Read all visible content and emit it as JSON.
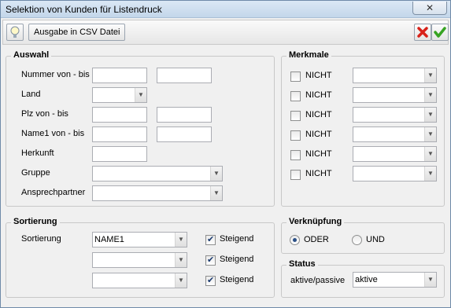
{
  "window": {
    "title": "Selektion von Kunden für Listendruck",
    "close_icon": "close-icon"
  },
  "toolbar": {
    "hint_icon": "lightbulb-icon",
    "csv_export_label": "Ausgabe in CSV Datei",
    "cancel_icon": "red-x-icon",
    "confirm_icon": "green-check-icon"
  },
  "auswahl": {
    "legend": "Auswahl",
    "fields": {
      "nummer": {
        "label": "Nummer von - bis",
        "from": "",
        "to": ""
      },
      "land": {
        "label": "Land",
        "value": ""
      },
      "plz": {
        "label": "Plz von - bis",
        "from": "",
        "to": ""
      },
      "name1": {
        "label": "Name1 von - bis",
        "from": "",
        "to": ""
      },
      "herkunft": {
        "label": "Herkunft",
        "value": ""
      },
      "gruppe": {
        "label": "Gruppe",
        "value": ""
      },
      "ansprechpartner": {
        "label": "Ansprechpartner",
        "value": ""
      }
    }
  },
  "merkmale": {
    "legend": "Merkmale",
    "rows": [
      {
        "label": "NICHT",
        "checked": false,
        "value": ""
      },
      {
        "label": "NICHT",
        "checked": false,
        "value": ""
      },
      {
        "label": "NICHT",
        "checked": false,
        "value": ""
      },
      {
        "label": "NICHT",
        "checked": false,
        "value": ""
      },
      {
        "label": "NICHT",
        "checked": false,
        "value": ""
      },
      {
        "label": "NICHT",
        "checked": false,
        "value": ""
      }
    ]
  },
  "sortierung": {
    "legend": "Sortierung",
    "label": "Sortierung",
    "rows": [
      {
        "value": "NAME1",
        "ascending_label": "Steigend",
        "ascending": true
      },
      {
        "value": "",
        "ascending_label": "Steigend",
        "ascending": true
      },
      {
        "value": "",
        "ascending_label": "Steigend",
        "ascending": true
      }
    ]
  },
  "verknuepfung": {
    "legend": "Verknüpfung",
    "options": [
      {
        "label": "ODER",
        "selected": true
      },
      {
        "label": "UND",
        "selected": false
      }
    ]
  },
  "status": {
    "legend": "Status",
    "label": "aktive/passive",
    "value": "aktive"
  }
}
